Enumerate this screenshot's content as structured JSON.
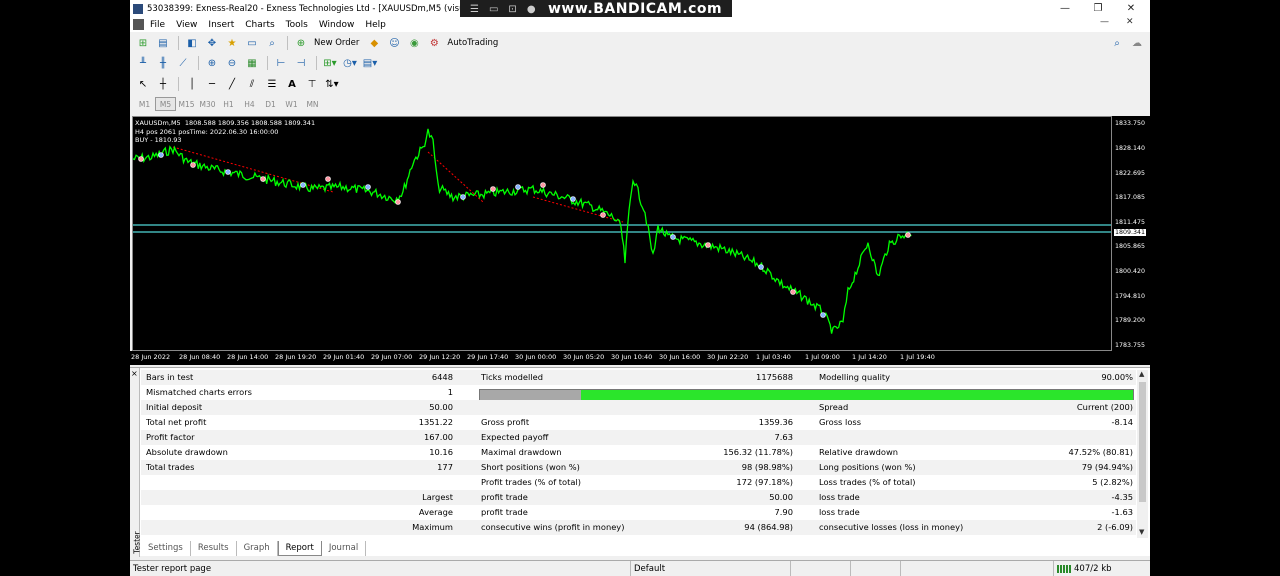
{
  "window": {
    "title": "53038399: Exness-Real20 - Exness Technologies Ltd - [XAUUSDm,M5 (visual)]",
    "minimize": "—",
    "maximize": "❐",
    "close": "✕"
  },
  "overlay": {
    "brand": "www.BANDICAM.com"
  },
  "menu": {
    "items": [
      "File",
      "View",
      "Insert",
      "Charts",
      "Tools",
      "Window",
      "Help"
    ],
    "child_minimize": "—",
    "child_close": "✕"
  },
  "toolbar": {
    "new_order": "New Order",
    "autotrading": "AutoTrading",
    "timeframes": [
      "M1",
      "M5",
      "M15",
      "M30",
      "H1",
      "H4",
      "D1",
      "W1",
      "MN"
    ],
    "active_timeframe": "M5",
    "text_tool": "A"
  },
  "chart": {
    "info_lines": [
      "XAUUSDm,M5  1808.588 1809.356 1808.588 1809.341",
      "H4 pos 2061 posTime: 2022.06.30 16:00:00",
      "BUY - 1810.93"
    ],
    "price_labels": [
      "1833.750",
      "1828.140",
      "1822.695",
      "1817.085",
      "1811.475",
      "1805.865",
      "1800.420",
      "1794.810",
      "1789.200",
      "1783.755"
    ],
    "current_price": "1809.341",
    "time_labels": [
      "28 Jun 2022",
      "28 Jun 08:40",
      "28 Jun 14:00",
      "28 Jun 19:20",
      "29 Jun 01:40",
      "29 Jun 07:00",
      "29 Jun 12:20",
      "29 Jun 17:40",
      "30 Jun 00:00",
      "30 Jun 05:20",
      "30 Jun 10:40",
      "30 Jun 16:00",
      "30 Jun 22:20",
      "1 Jul 03:40",
      "1 Jul 09:00",
      "1 Jul 14:20",
      "1 Jul 19:40"
    ],
    "colors": {
      "background": "#000000",
      "price_line": "#00ff00",
      "level_line": "#4fd6d6",
      "trend_line": "#ff0000"
    }
  },
  "report": {
    "row1": {
      "l1": "Bars in test",
      "v1": "6448",
      "l2": "Ticks modelled",
      "v2": "1175688",
      "l3": "Modelling quality",
      "v3": "90.00%"
    },
    "row2": {
      "l1": "Mismatched charts errors",
      "v1": "1"
    },
    "progress_fraction": 0.155,
    "row3": {
      "l1": "Initial deposit",
      "v1": "50.00",
      "l3": "Spread",
      "v3": "Current (200)"
    },
    "row4": {
      "l1": "Total net profit",
      "v1": "1351.22",
      "l2": "Gross profit",
      "v2": "1359.36",
      "l3": "Gross loss",
      "v3": "-8.14"
    },
    "row5": {
      "l1": "Profit factor",
      "v1": "167.00",
      "l2": "Expected payoff",
      "v2": "7.63"
    },
    "row6": {
      "l1": "Absolute drawdown",
      "v1": "10.16",
      "l2": "Maximal drawdown",
      "v2": "156.32 (11.78%)",
      "l3": "Relative drawdown",
      "v3": "47.52% (80.81)"
    },
    "row7": {
      "l1": "Total trades",
      "v1": "177",
      "l2": "Short positions (won %)",
      "v2": "98 (98.98%)",
      "l3": "Long positions (won %)",
      "v3": "79 (94.94%)"
    },
    "row8": {
      "l2": "Profit trades (% of total)",
      "v2": "172 (97.18%)",
      "l3": "Loss trades (% of total)",
      "v3": "5 (2.82%)"
    },
    "row9": {
      "lr": "Largest",
      "l2": "profit trade",
      "v2": "50.00",
      "l3": "loss trade",
      "v3": "-4.35"
    },
    "row10": {
      "lr": "Average",
      "l2": "profit trade",
      "v2": "7.90",
      "l3": "loss trade",
      "v3": "-1.63"
    },
    "row11": {
      "lr": "Maximum",
      "l2": "consecutive wins (profit in money)",
      "v2": "94 (864.98)",
      "l3": "consecutive losses (loss in money)",
      "v3": "2 (-6.09)"
    }
  },
  "tester": {
    "side_label": "Tester",
    "close": "×"
  },
  "tabs": [
    "Settings",
    "Results",
    "Graph",
    "Report",
    "Journal"
  ],
  "active_tab": "Report",
  "status": {
    "left": "Tester report page",
    "profile": "Default",
    "traffic": "407/2 kb"
  }
}
